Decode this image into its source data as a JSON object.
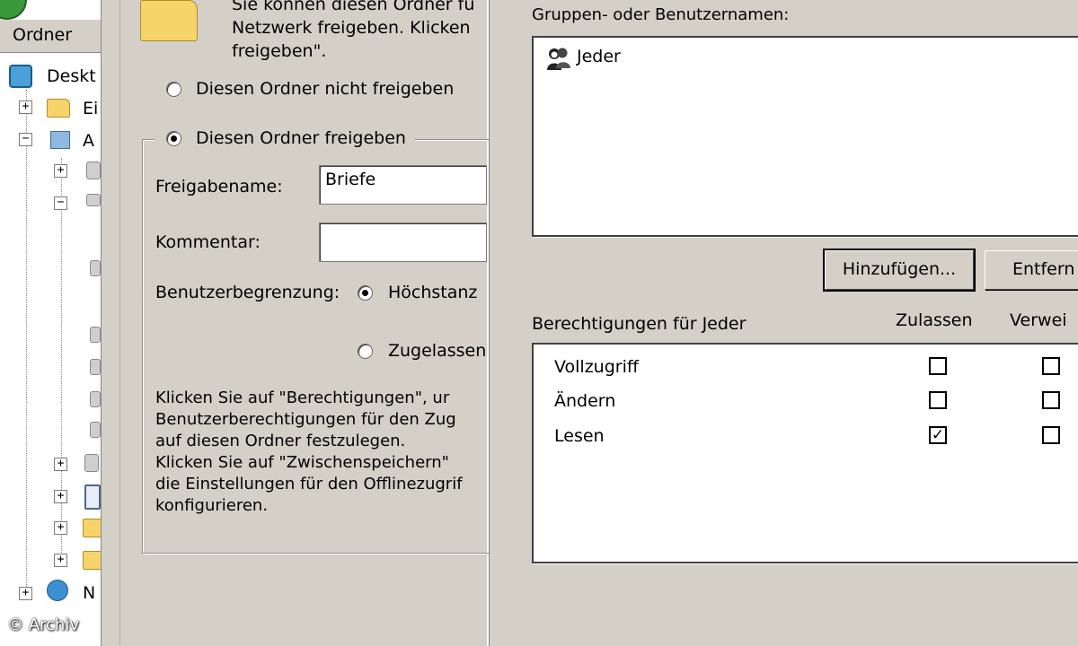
{
  "explorer": {
    "header": "Ordner",
    "tree": [
      {
        "label": "Deskt",
        "expander": ""
      },
      {
        "label": "Ei",
        "expander": "+"
      },
      {
        "label": "A",
        "expander": "−"
      },
      {
        "label": "N",
        "expander": "+"
      }
    ],
    "watermark": "© Archiv"
  },
  "share_dialog": {
    "intro": "Sie können diesen Ordner fü\nNetzwerk freigeben. Klicken\nfreigeben\".",
    "radio_no_share": "Diesen Ordner nicht freigeben",
    "radio_share": "Diesen Ordner freigeben",
    "share_name_label": "Freigabename:",
    "share_name_value": "Briefe",
    "comment_label": "Kommentar:",
    "comment_value": "",
    "user_limit_label": "Benutzerbegrenzung:",
    "radio_max": "Höchstanz",
    "radio_allowed": "Zugelassen",
    "help_text": "Klicken Sie auf \"Berechtigungen\", ur\nBenutzerberechtigungen für den Zug\nauf diesen Ordner festzulegen.\nKlicken Sie auf \"Zwischenspeichern\"\ndie Einstellungen für den Offlinezugrif\nkonfigurieren."
  },
  "permissions": {
    "groups_label": "Gruppen- oder Benutzernamen:",
    "users": [
      {
        "name": "Jeder",
        "icon": "user-group-icon"
      }
    ],
    "add_button": "Hinzufügen...",
    "remove_button": "Entfern",
    "perm_label": "Berechtigungen für Jeder",
    "col_allow": "Zulassen",
    "col_deny": "Verwei",
    "rows": [
      {
        "name": "Vollzugriff",
        "allow": false,
        "deny": false
      },
      {
        "name": "Ändern",
        "allow": false,
        "deny": false
      },
      {
        "name": "Lesen",
        "allow": true,
        "deny": false
      }
    ]
  }
}
